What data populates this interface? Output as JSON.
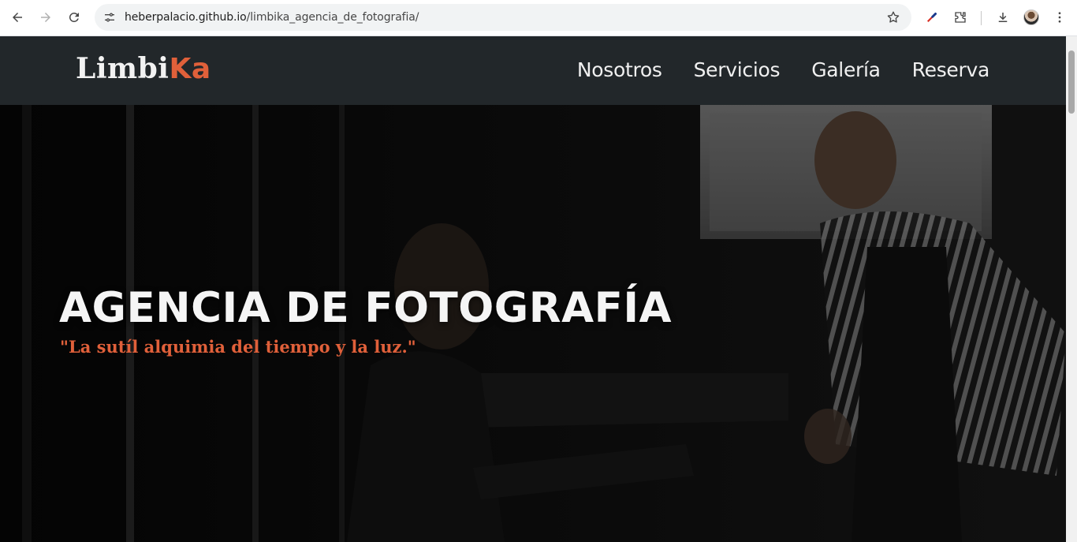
{
  "browser": {
    "url_domain": "heberpalacio.github.io",
    "url_path": "/limbika_agencia_de_fotografia/"
  },
  "site": {
    "logo_main": "Limbi",
    "logo_accent": "Ka",
    "nav": [
      "Nosotros",
      "Servicios",
      "Galería",
      "Reserva"
    ],
    "hero_title": "AGENCIA DE FOTOGRAFÍA",
    "hero_subtitle": "\"La sutíl alquimia del tiempo y la luz.\""
  },
  "colors": {
    "accent": "#e0603a",
    "header_bg": "#22272a"
  }
}
